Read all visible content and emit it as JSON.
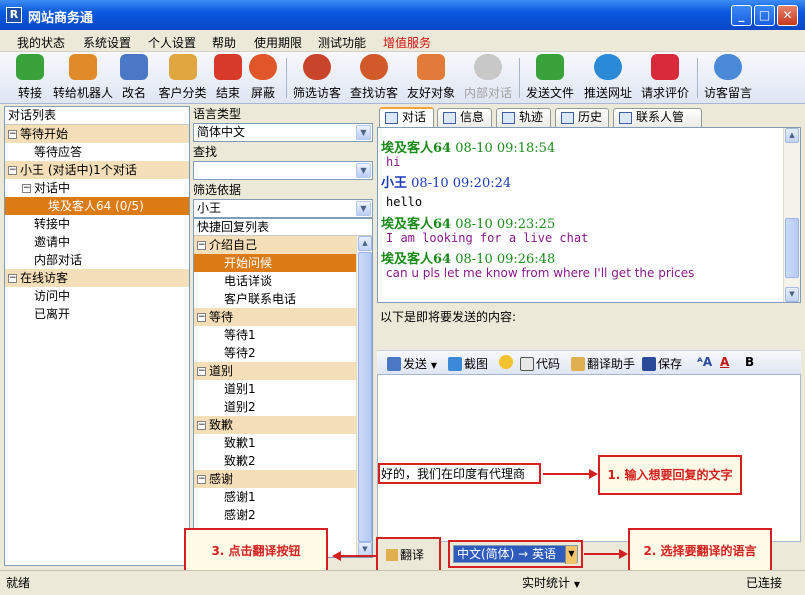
{
  "window": {
    "title": "网站商务通",
    "app_icon": "R"
  },
  "menu": [
    "我的状态",
    "系统设置",
    "个人设置",
    "帮助",
    "使用期限",
    "测试功能",
    "增值服务"
  ],
  "toolbar": [
    {
      "label": "转接",
      "icon": "transfer-icon",
      "color": "#3aa23a"
    },
    {
      "label": "转给机器人",
      "icon": "robot-icon",
      "color": "#e08a2a"
    },
    {
      "label": "改名",
      "icon": "rename-icon",
      "color": "#4a78c4"
    },
    {
      "label": "客户分类",
      "icon": "classify-icon",
      "color": "#e0a640"
    },
    {
      "label": "结束",
      "icon": "end-icon",
      "color": "#d83a2a"
    },
    {
      "label": "屏蔽",
      "icon": "block-icon",
      "color": "#e0552a"
    },
    {
      "label": "筛选访客",
      "icon": "filter-visitor-icon",
      "color": "#c8442a"
    },
    {
      "label": "查找访客",
      "icon": "find-visitor-icon",
      "color": "#d25a2a"
    },
    {
      "label": "友好对象",
      "icon": "friend-icon",
      "color": "#e27a3a"
    },
    {
      "label": "内部对话",
      "icon": "internal-chat-icon",
      "color": "#b8b8b8",
      "disabled": true
    },
    {
      "label": "发送文件",
      "icon": "send-file-icon",
      "color": "#3aa23a"
    },
    {
      "label": "推送网址",
      "icon": "push-url-icon",
      "color": "#2a8ad8"
    },
    {
      "label": "请求评价",
      "icon": "request-rating-icon",
      "color": "#d82a3a"
    },
    {
      "label": "访客留言",
      "icon": "visitor-message-icon",
      "color": "#4a8ad8"
    }
  ],
  "left_panel": {
    "header": "对话列表",
    "rows": [
      {
        "text": "等待开始",
        "type": "group"
      },
      {
        "text": "等待应答",
        "type": "item"
      },
      {
        "text": "小王 (对话中)1个对话",
        "type": "group"
      },
      {
        "text": "对话中",
        "type": "sub"
      },
      {
        "text": "埃及客人64 (0/5)",
        "type": "selected"
      },
      {
        "text": "转接中",
        "type": "item"
      },
      {
        "text": "邀请中",
        "type": "item"
      },
      {
        "text": "内部对话",
        "type": "item"
      },
      {
        "text": "在线访客",
        "type": "group"
      },
      {
        "text": "访问中",
        "type": "item"
      },
      {
        "text": "已离开",
        "type": "item"
      }
    ]
  },
  "mid_panel": {
    "language_label": "语言类型",
    "language_value": "简体中文",
    "search_label": "查找",
    "search_value": "",
    "filter_label": "筛选依据",
    "filter_value": "小王",
    "quick_header": "快捷回复列表",
    "quick_rows": [
      {
        "text": "介绍自己",
        "type": "group"
      },
      {
        "text": "开始问候",
        "type": "selected"
      },
      {
        "text": "电话详谈",
        "type": "item"
      },
      {
        "text": "客户联系电话",
        "type": "item"
      },
      {
        "text": "等待",
        "type": "group"
      },
      {
        "text": "等待1",
        "type": "item"
      },
      {
        "text": "等待2",
        "type": "item"
      },
      {
        "text": "道别",
        "type": "group"
      },
      {
        "text": "道别1",
        "type": "item"
      },
      {
        "text": "道别2",
        "type": "item"
      },
      {
        "text": "致歉",
        "type": "group"
      },
      {
        "text": "致歉1",
        "type": "item"
      },
      {
        "text": "致歉2",
        "type": "item"
      },
      {
        "text": "感谢",
        "type": "group"
      },
      {
        "text": "感谢1",
        "type": "item"
      },
      {
        "text": "感谢2",
        "type": "item"
      }
    ]
  },
  "tabs": [
    "对话",
    "信息",
    "轨迹",
    "历史",
    "联系人管理"
  ],
  "chat": [
    {
      "sender": "埃及客人64",
      "time": "08-10 09:18:54",
      "sender_color": "#1a8a1a",
      "body": "hi",
      "body_color": "#8a1a8a",
      "mono": true
    },
    {
      "sender": "小王",
      "time": "08-10 09:20:24",
      "sender_color": "#1a3ab8",
      "body": "hello",
      "body_color": "#000000",
      "mono": true
    },
    {
      "sender": "埃及客人64",
      "time": "08-10 09:23:25",
      "sender_color": "#1a8a1a",
      "body": "I am looking for a live chat",
      "body_color": "#8a1a8a",
      "mono": true
    },
    {
      "sender": "埃及客人64",
      "time": "08-10 09:26:48",
      "sender_color": "#1a8a1a",
      "body": "can u pls let me know from where I'll get the prices",
      "body_color": "#8a1a8a",
      "mono": false
    }
  ],
  "send_label": "以下是即将要发送的内容:",
  "editor_toolbar": [
    "发送",
    "截图",
    "代码",
    "翻译助手",
    "保存",
    "B"
  ],
  "editor_text": "好的，我们在印度有代理商",
  "translate": {
    "button": "翻译",
    "language": "中文(简体) → 英语",
    "tooltip": "翻译"
  },
  "annotations": {
    "a1": "1. 输入想要回复的文字",
    "a2": "2. 选择要翻译的语言",
    "a3": "3. 点击翻译按钮"
  },
  "status": {
    "left": "就绪",
    "mid": "实时统计",
    "right": "已连接"
  }
}
